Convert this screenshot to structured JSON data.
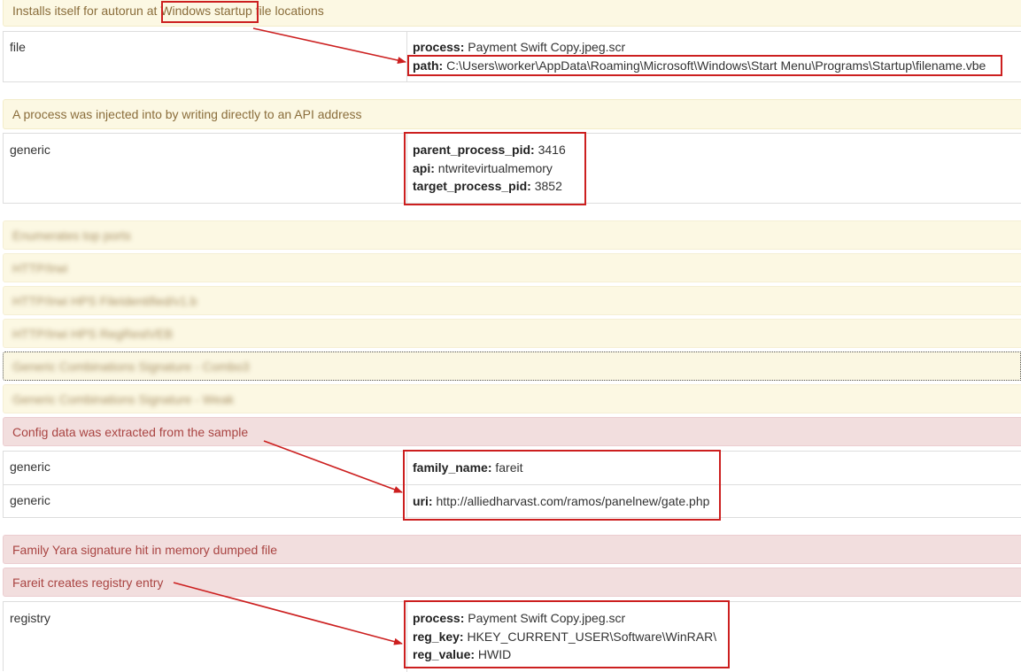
{
  "sections": {
    "autorun": {
      "title_before": "Installs itself for autorun at ",
      "title_highlight": "Windows startup",
      "title_after": " file locations",
      "category": "file",
      "fields": [
        {
          "key": "process:",
          "value": " Payment Swift Copy.jpeg.scr"
        },
        {
          "key": "path:",
          "value": " C:\\Users\\worker\\AppData\\Roaming\\Microsoft\\Windows\\Start Menu\\Programs\\Startup\\filename.vbe"
        }
      ]
    },
    "injection": {
      "title": "A process was injected into by writing directly to an API address",
      "category": "generic",
      "fields": [
        {
          "key": "parent_process_pid:",
          "value": " 3416"
        },
        {
          "key": "api:",
          "value": " ntwritevirtualmemory"
        },
        {
          "key": "target_process_pid:",
          "value": " 3852"
        }
      ]
    },
    "blurred": [
      "Enumerates top ports",
      "HTTP/Irwi",
      "HTTP/Irwi HPS FileIdentified/v1.b",
      "HTTP/Irwi HPS RegRestVEB",
      "Generic Combinations Signature - Combo3",
      "Generic Combinations Signature - Weak"
    ],
    "config": {
      "title": "Config data was extracted from the sample",
      "rows": [
        {
          "category": "generic",
          "key": "family_name:",
          "value": " fareit"
        },
        {
          "category": "generic",
          "key": "uri:",
          "value": " http://alliedharvast.com/ramos/panelnew/gate.php"
        }
      ]
    },
    "yara": {
      "title": "Family Yara signature hit in memory dumped file"
    },
    "registry": {
      "title": "Fareit creates registry entry",
      "category": "registry",
      "fields": [
        {
          "key": "process:",
          "value": " Payment Swift Copy.jpeg.scr"
        },
        {
          "key": "reg_key:",
          "value": " HKEY_CURRENT_USER\\Software\\WinRAR\\"
        },
        {
          "key": "reg_value:",
          "value": " HWID"
        }
      ]
    }
  },
  "colors": {
    "warning_bg": "#fcf8e3",
    "warning_text": "#8a6d3b",
    "danger_bg": "#f2dede",
    "danger_text": "#a94442",
    "annotation_red": "#cc1f1f"
  }
}
